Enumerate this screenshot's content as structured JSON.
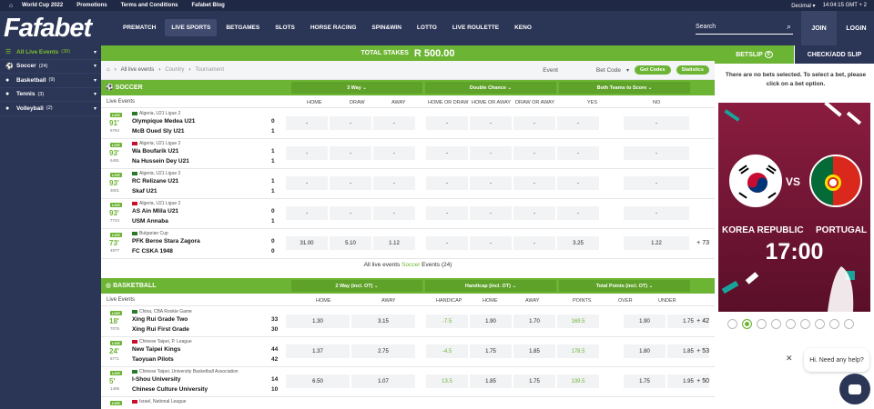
{
  "topbar": {
    "home_icon": "home-icon",
    "links": [
      "World Cup 2022",
      "Promotions",
      "Terms and Conditions",
      "Fafabet Blog"
    ],
    "odds_format": "Decimal",
    "time": "14:04:15 GMT + 2"
  },
  "header": {
    "logo": "Fafabet",
    "nav": [
      "PREMATCH",
      "LIVE SPORTS",
      "BETGAMES",
      "SLOTS",
      "HORSE RACING",
      "SPIN&WIN",
      "LOTTO",
      "LIVE ROULETTE",
      "KENO"
    ],
    "active_nav": "LIVE SPORTS",
    "search_placeholder": "Search",
    "join": "JOIN",
    "login": "LOGIN"
  },
  "sidebar": {
    "items": [
      {
        "label": "All Live Events",
        "count": "(38)",
        "active": true
      },
      {
        "label": "Soccer",
        "count": "(24)"
      },
      {
        "label": "Basketball",
        "count": "(9)"
      },
      {
        "label": "Tennis",
        "count": "(3)"
      },
      {
        "label": "Volleyball",
        "count": "(2)"
      }
    ]
  },
  "stakes": {
    "label": "TOTAL STAKES",
    "currency": "R",
    "amount": "500.00"
  },
  "breadcrumb": {
    "items": [
      "All live events",
      "Country",
      "Tournament"
    ],
    "event_label": "Event",
    "betcode_label": "Bet Code",
    "get_codes": "Get Codes",
    "statistics": "Statistics"
  },
  "soccer": {
    "title": "SOCCER",
    "dropdowns": [
      "3 Way",
      "Double Chance",
      "Both Teams to Score"
    ],
    "live_events": "Live Events",
    "columns": [
      "HOME",
      "DRAW",
      "AWAY",
      "HOME OR DRAW",
      "HOME OR AWAY",
      "DRAW OR AWAY",
      "YES",
      "NO"
    ],
    "rows": [
      {
        "live": "LIVE",
        "minute": "91'",
        "id": "5794",
        "league": "Algeria, U21 Ligue 2",
        "home": "Olympique Medea U21",
        "away": "McB Oued Sly U21",
        "s1": "0",
        "s2": "1",
        "odds": [
          "-",
          "-",
          "-",
          "-",
          "-",
          "-",
          "-",
          "-"
        ],
        "more": ""
      },
      {
        "live": "LIVE",
        "minute": "93'",
        "id": "6491",
        "league": "Algeria, U21 Ligue 2",
        "home": "Wa Boufarik U21",
        "away": "Na Hussein Dey U21",
        "s1": "1",
        "s2": "1",
        "odds": [
          "-",
          "-",
          "-",
          "-",
          "-",
          "-",
          "-",
          "-"
        ],
        "more": ""
      },
      {
        "live": "LIVE",
        "minute": "93'",
        "id": "3001",
        "league": "Algeria, U21 Ligue 2",
        "home": "RC Relizane U21",
        "away": "Skaf U21",
        "s1": "1",
        "s2": "1",
        "odds": [
          "-",
          "-",
          "-",
          "-",
          "-",
          "-",
          "-",
          "-"
        ],
        "more": ""
      },
      {
        "live": "LIVE",
        "minute": "93'",
        "id": "7724",
        "league": "Algeria, U21 Ligue 2",
        "home": "AS Ain Mlila U21",
        "away": "USM Annaba",
        "s1": "0",
        "s2": "1",
        "odds": [
          "-",
          "-",
          "-",
          "-",
          "-",
          "-",
          "-",
          "-"
        ],
        "more": ""
      },
      {
        "live": "LIVE",
        "minute": "73'",
        "id": "4977",
        "league": "Bulgarian Cup",
        "home": "PFK Beroe Stara Zagora",
        "away": "FC CSKA 1948",
        "s1": "0",
        "s2": "0",
        "odds": [
          "31.00",
          "5.10",
          "1.12",
          "-",
          "-",
          "-",
          "3.25",
          "1.22"
        ],
        "more": "+ 73"
      }
    ]
  },
  "all_live": {
    "a": "All live events",
    "b": "Soccer",
    "c": "Events (24)"
  },
  "basketball": {
    "title": "BASKETBALL",
    "dropdowns": [
      "2 Way (incl. OT)",
      "Handicap (incl. OT)",
      "Total Points (incl. OT)"
    ],
    "live_events": "Live Events",
    "columns": [
      "HOME",
      "AWAY",
      "HANDICAP",
      "HOME",
      "AWAY",
      "POINTS",
      "OVER",
      "UNDER"
    ],
    "rows": [
      {
        "live": "LIVE",
        "minute": "18'",
        "id": "7075",
        "league": "China, CBA Rookie Game",
        "home": "Xing Rui Grade Two",
        "away": "Xing Rui First Grade",
        "s1": "33",
        "s2": "30",
        "odds": [
          "1.30",
          "3.15",
          "-7.5",
          "1.90",
          "1.70",
          "169.5",
          "1.90",
          "1.75"
        ],
        "more": "+ 42"
      },
      {
        "live": "LIVE",
        "minute": "24'",
        "id": "8771",
        "league": "Chinese Taipei, P. League",
        "home": "New Taipei Kings",
        "away": "Taoyuan Pilots",
        "s1": "44",
        "s2": "42",
        "odds": [
          "1.37",
          "2.75",
          "-4.5",
          "1.75",
          "1.85",
          "178.5",
          "1.80",
          "1.85"
        ],
        "more": "+ 53"
      },
      {
        "live": "LIVE",
        "minute": "5'",
        "id": "1405",
        "league": "Chinese Taipei, University Basketball Association",
        "home": "I-Shou University",
        "away": "Chinese Culture University",
        "s1": "14",
        "s2": "10",
        "odds": [
          "6.50",
          "1.07",
          "13.5",
          "1.85",
          "1.75",
          "139.5",
          "1.75",
          "1.95"
        ],
        "more": "+ 50"
      },
      {
        "live": "LIVE",
        "minute": "",
        "id": "",
        "league": "Israel, National League",
        "home": "",
        "away": "",
        "s1": "",
        "s2": "",
        "odds": [
          "",
          "",
          "",
          "",
          "",
          "",
          "",
          ""
        ],
        "more": ""
      }
    ]
  },
  "betslip": {
    "tab1": "BETSLIP",
    "tab1_count": "0",
    "tab2": "CHECK/ADD SLIP",
    "message": "There are no bets selected. To select a bet, please click on a bet option.",
    "promo": {
      "team1": "KOREA REPUBLIC",
      "vs": "VS",
      "team2": "PORTUGAL",
      "time": "17:00"
    }
  },
  "chat": {
    "greeting": "Hi. Need any help?"
  },
  "colors": {
    "green": "#6cb433",
    "navy": "#2b3556"
  }
}
